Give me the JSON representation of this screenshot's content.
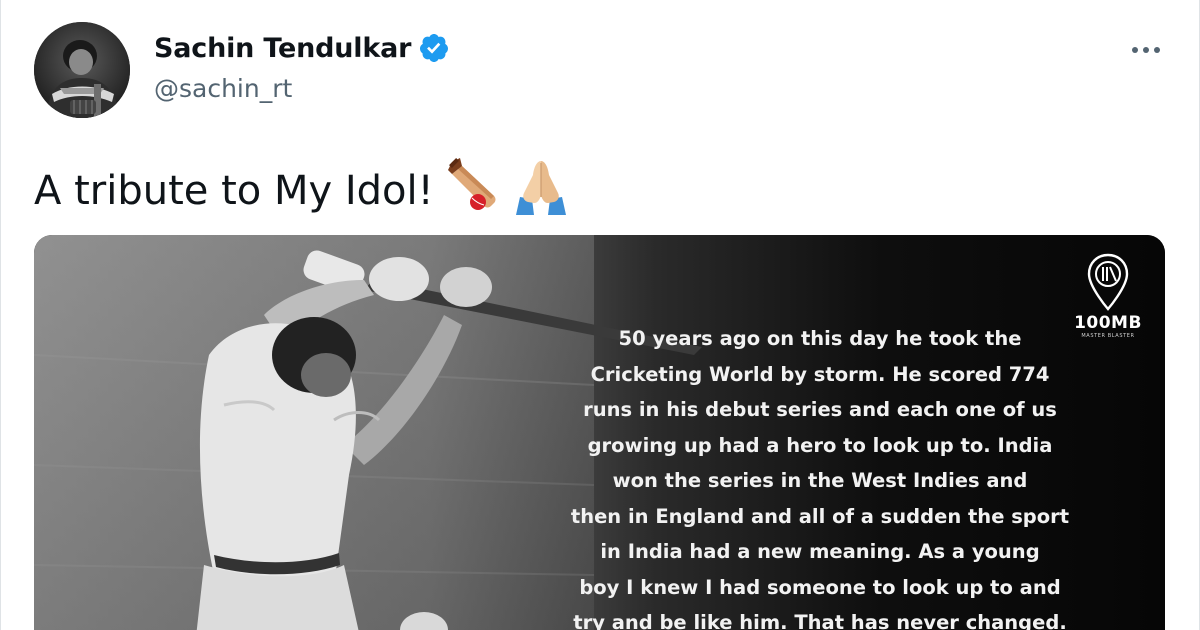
{
  "tweet": {
    "author": {
      "display_name": "Sachin Tendulkar",
      "handle": "@sachin_rt",
      "verified": true,
      "verified_icon": "verified-badge-icon",
      "avatar_icon": "profile-photo"
    },
    "more_icon": "more-options-icon",
    "text": "A tribute to My Idol!",
    "emojis": [
      "cricket-bat-and-ball-emoji",
      "folded-hands-emoji"
    ],
    "media": {
      "logo_text": "100MB",
      "logo_subtext": "MASTER BLASTER",
      "overlay_lines": [
        "50 years ago on this day he took the",
        "Cricketing World by storm. He scored 774",
        "runs in his debut series and each one of us",
        "growing up had a hero to look up to. India",
        "won the series in the West Indies and",
        "then in England and all of a sudden the sport",
        "in India had a new meaning. As a young",
        "boy I knew I had someone to look up to and",
        "try and be like him. That has never changed."
      ]
    }
  },
  "colors": {
    "verified_blue": "#1d9bf0",
    "text_primary": "#0f1419",
    "text_secondary": "#536471"
  }
}
